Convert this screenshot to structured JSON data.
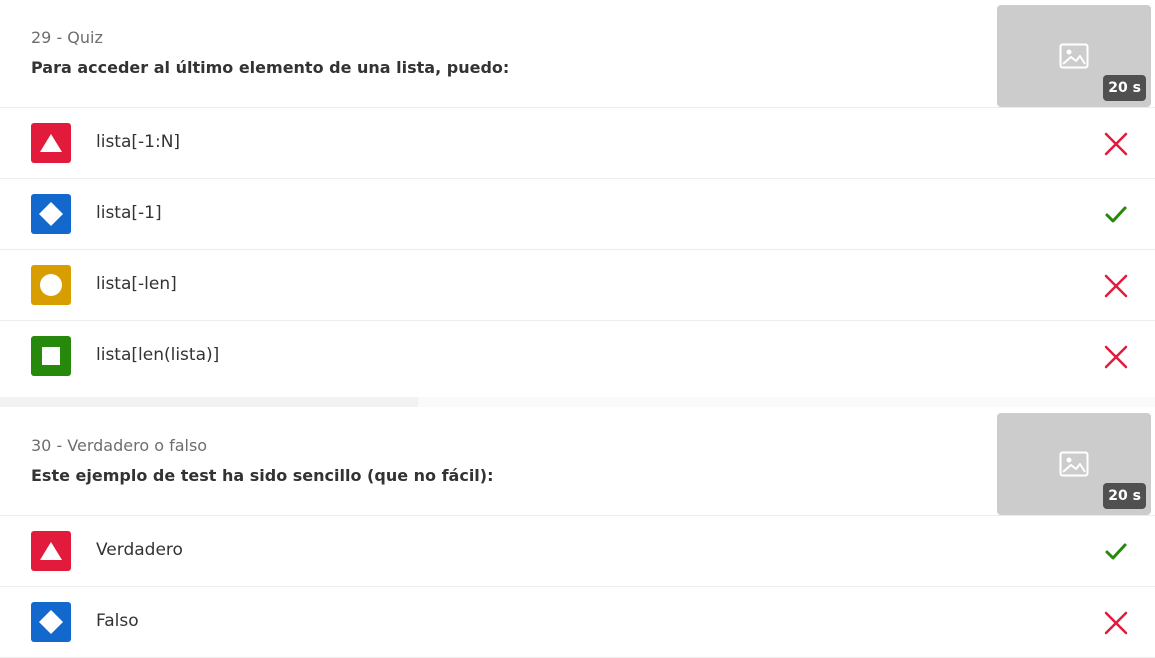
{
  "colors": {
    "triangle": "#e21b3c",
    "diamond": "#1368ce",
    "circle": "#d89e00",
    "square": "#26890c",
    "correct": "#26890c",
    "incorrect": "#e21b3c"
  },
  "questions": [
    {
      "type_label": "29 - Quiz",
      "text": "Para acceder al último elemento de una lista, puedo:",
      "image_icon": "image-placeholder-icon",
      "time": "20 s",
      "answers": [
        {
          "shape": "triangle",
          "text": "lista[-1:N]",
          "correct": false
        },
        {
          "shape": "diamond",
          "text": "lista[-1]",
          "correct": true
        },
        {
          "shape": "circle",
          "text": "lista[-len]",
          "correct": false
        },
        {
          "shape": "square",
          "text": "lista[len(lista)]",
          "correct": false
        }
      ]
    },
    {
      "type_label": "30 - Verdadero o falso",
      "text": "Este ejemplo de test ha sido sencillo (que no fácil):",
      "image_icon": "image-placeholder-icon",
      "time": "20 s",
      "answers": [
        {
          "shape": "triangle",
          "text": "Verdadero",
          "correct": true
        },
        {
          "shape": "diamond",
          "text": "Falso",
          "correct": false
        }
      ]
    }
  ]
}
